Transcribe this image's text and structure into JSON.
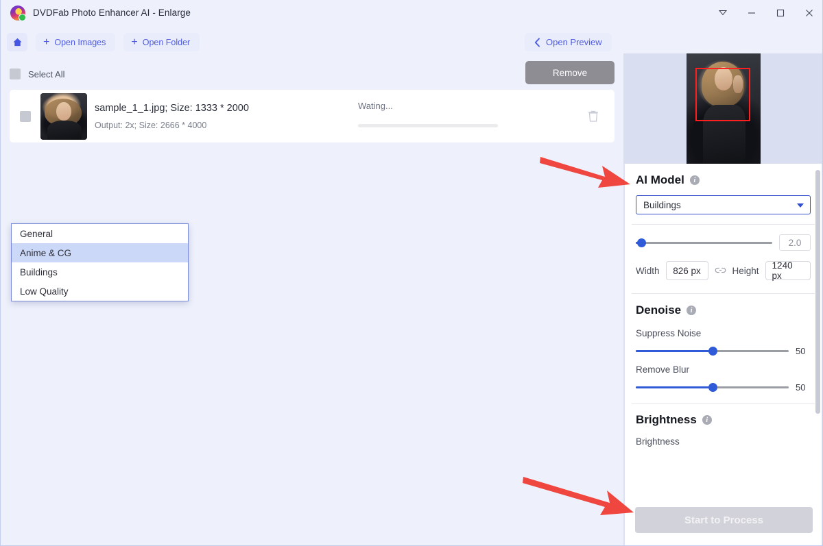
{
  "window": {
    "title": "DVDFab Photo Enhancer AI - Enlarge",
    "controls": [
      {
        "name": "collapse-button",
        "glyph": "collapse"
      },
      {
        "name": "minimize-button",
        "glyph": "minimize"
      },
      {
        "name": "maximize-button",
        "glyph": "maximize"
      },
      {
        "name": "close-button",
        "glyph": "close"
      }
    ]
  },
  "toolbar": {
    "home_icon": "home-icon",
    "open_images_label": "Open Images",
    "open_folder_label": "Open Folder",
    "plus_glyph": "+",
    "open_preview_label": "Open Preview",
    "back_chevron": "‹"
  },
  "filelist": {
    "select_all_label": "Select All",
    "remove_label": "Remove",
    "rows": [
      {
        "name": "sample_1_1.jpg; Size: 1333 * 2000",
        "output": "Output: 2x; Size: 2666 * 4000",
        "status": "Wating...",
        "progress_percent": 0,
        "delete_icon": "trash-icon"
      }
    ]
  },
  "panel": {
    "ai_model": {
      "title": "AI Model",
      "info_glyph": "i",
      "selected": "Buildings",
      "options": [
        "General",
        "Anime & CG",
        "Buildings",
        "Low Quality"
      ],
      "highlighted_option": "Anime & CG"
    },
    "scale": {
      "value": "2.0",
      "slider_percent": 4
    },
    "dimensions": {
      "width_label": "Width",
      "width_value": "826 px",
      "height_label": "Height",
      "height_value": "1240 px",
      "link_icon": "link-icon"
    },
    "denoise": {
      "title": "Denoise",
      "info_glyph": "i",
      "sliders": [
        {
          "label": "Suppress Noise",
          "value": "50",
          "percent": 50
        },
        {
          "label": "Remove Blur",
          "value": "50",
          "percent": 50
        }
      ]
    },
    "brightness": {
      "title": "Brightness",
      "info_glyph": "i",
      "partial_label": "Brightness"
    },
    "start_button": {
      "label": "Start to Process",
      "enabled": false
    }
  },
  "colors": {
    "accent_blue": "#4f5ce0",
    "slider_blue": "#2f5bd8",
    "arrow_red": "#ef4640",
    "window_bg": "#eef1fc",
    "panel_bg": "#dde1f3",
    "disabled_gray": "#d2d3da"
  }
}
